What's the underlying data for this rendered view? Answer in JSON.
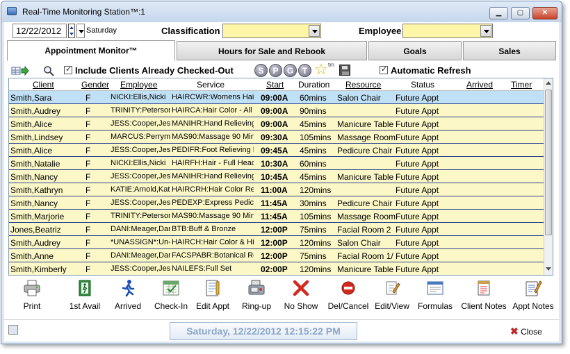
{
  "window": {
    "title": "Real-Time Monitoring Station™:1",
    "min": "▁",
    "max": "▢",
    "close": "✕"
  },
  "filters": {
    "date": "12/22/2012",
    "weekday": "Saturday",
    "classification_label": "Classification",
    "classification_value": "",
    "employee_label": "Employee",
    "employee_value": ""
  },
  "tabs": [
    {
      "label": "Appointment Monitor™",
      "active": true
    },
    {
      "label": "Hours for Sale and Rebook"
    },
    {
      "label": "Goals"
    },
    {
      "label": "Sales"
    }
  ],
  "toolbar": {
    "include_checked_out_label": "Include Clients Already Checked-Out",
    "include_checked_out": true,
    "circles": [
      "S",
      "P",
      "G",
      "T"
    ],
    "tm": "tm",
    "auto_refresh_label": "Automatic Refresh",
    "auto_refresh": true
  },
  "grid": {
    "columns": [
      "Client",
      "Gender",
      "Employee",
      "Service",
      "Start",
      "Duration",
      "Resource",
      "Status",
      "Arrived",
      "Timer"
    ],
    "rows": [
      {
        "client": "Smith,Sara",
        "gender": "F",
        "employee": "NICKI:Ellis,Nicki",
        "service": "HAIRCWR:Womens Hair",
        "start": "09:00A",
        "duration": "60mins",
        "resource": "Salon Chair",
        "status": "Future Appt",
        "arrived": "",
        "timer": ""
      },
      {
        "client": "Smith,Audrey",
        "gender": "F",
        "employee": "TRINITY:Peterson",
        "service": "HAIRCA:Hair Color - All",
        "start": "09:00A",
        "duration": "90mins",
        "resource": "",
        "status": "Future Appt",
        "arrived": "",
        "timer": ""
      },
      {
        "client": "Smith,Alice",
        "gender": "F",
        "employee": "JESS:Cooper,Jes",
        "service": "MANIHR:Hand Relieving",
        "start": "09:00A",
        "duration": "45mins",
        "resource": "Manicure Table",
        "status": "Future Appt",
        "arrived": "",
        "timer": ""
      },
      {
        "client": "Smith,Lindsey",
        "gender": "F",
        "employee": "MARCUS:Perrym",
        "service": "MAS90:Massage 90 Min",
        "start": "09:30A",
        "duration": "105mins",
        "resource": "Massage Room",
        "status": "Future Appt",
        "arrived": "",
        "timer": ""
      },
      {
        "client": "Smith,Alice",
        "gender": "F",
        "employee": "JESS:Cooper,Jes",
        "service": "PEDIFR:Foot Relieving P",
        "start": "09:45A",
        "duration": "45mins",
        "resource": "Pedicure Chair",
        "status": "Future Appt",
        "arrived": "",
        "timer": ""
      },
      {
        "client": "Smith,Natalie",
        "gender": "F",
        "employee": "NICKI:Ellis,Nicki",
        "service": "HAIRFH:Hair - Full Head",
        "start": "10:30A",
        "duration": "60mins",
        "resource": "",
        "status": "Future Appt",
        "arrived": "",
        "timer": ""
      },
      {
        "client": "Smith,Nancy",
        "gender": "F",
        "employee": "JESS:Cooper,Jes",
        "service": "MANIHR:Hand Relieving",
        "start": "10:45A",
        "duration": "45mins",
        "resource": "Manicure Table",
        "status": "Future Appt",
        "arrived": "",
        "timer": ""
      },
      {
        "client": "Smith,Kathryn",
        "gender": "F",
        "employee": "KATIE:Arnold,Kat",
        "service": "HAIRCRH:Hair Color Ret",
        "start": "11:00A",
        "duration": "120mins",
        "resource": "",
        "status": "Future Appt",
        "arrived": "",
        "timer": ""
      },
      {
        "client": "Smith,Nancy",
        "gender": "F",
        "employee": "JESS:Cooper,Jes",
        "service": "PEDEXP:Express Pedicu",
        "start": "11:45A",
        "duration": "30mins",
        "resource": "Pedicure Chair",
        "status": "Future Appt",
        "arrived": "",
        "timer": ""
      },
      {
        "client": "Smith,Marjorie",
        "gender": "F",
        "employee": "TRINITY:Peterson",
        "service": "MAS90:Massage 90 Min",
        "start": "11:45A",
        "duration": "105mins",
        "resource": "Massage Room",
        "status": "Future Appt",
        "arrived": "",
        "timer": ""
      },
      {
        "client": "Jones,Beatriz",
        "gender": "F",
        "employee": "DANI:Meager,Dan",
        "service": "BTB:Buff & Bronze",
        "start": "12:00P",
        "duration": "75mins",
        "resource": "Facial Room 2",
        "status": "Future Appt",
        "arrived": "",
        "timer": ""
      },
      {
        "client": "Smith,Audrey",
        "gender": "F",
        "employee": "*UNASSIGN*:Un-/",
        "service": "HAIRCH:Hair Color & Hig",
        "start": "12:00P",
        "duration": "120mins",
        "resource": "Salon Chair",
        "status": "Future Appt",
        "arrived": "",
        "timer": ""
      },
      {
        "client": "Smith,Anne",
        "gender": "F",
        "employee": "DANI:Meager,Dar",
        "service": "FACSPABR:Botanical Re",
        "start": "12:00P",
        "duration": "75mins",
        "resource": "Facial Room 1/",
        "status": "Future Appt",
        "arrived": "",
        "timer": ""
      },
      {
        "client": "Smith,Kimberly",
        "gender": "F",
        "employee": "JESS:Cooper,Jes",
        "service": "NAILEFS:Full Set",
        "start": "02:00P",
        "duration": "120mins",
        "resource": "Manicure Table",
        "status": "Future Appt",
        "arrived": "",
        "timer": ""
      }
    ]
  },
  "actions": [
    {
      "name": "print-button",
      "icon": "printer-icon",
      "label": "Print"
    },
    {
      "name": "first-available-button",
      "icon": "door-exit-icon",
      "label": "1st Avail"
    },
    {
      "name": "arrived-button",
      "icon": "running-person-icon",
      "label": "Arrived"
    },
    {
      "name": "check-in-button",
      "icon": "calendar-check-icon",
      "label": "Check-In"
    },
    {
      "name": "edit-appt-button",
      "icon": "edit-notebook-icon",
      "label": "Edit Appt"
    },
    {
      "name": "ring-up-button",
      "icon": "cash-register-icon",
      "label": "Ring-up"
    },
    {
      "name": "no-show-button",
      "icon": "red-x-icon",
      "label": "No Show"
    },
    {
      "name": "del-cancel-button",
      "icon": "no-entry-icon",
      "label": "Del/Cancel"
    },
    {
      "name": "edit-view-button",
      "icon": "pencil-note-icon",
      "label": "Edit/View"
    },
    {
      "name": "formulas-button",
      "icon": "formula-window-icon",
      "label": "Formulas"
    },
    {
      "name": "client-notes-button",
      "icon": "notepad-icon",
      "label": "Client Notes"
    },
    {
      "name": "appt-notes-button",
      "icon": "notepad-pen-icon",
      "label": "Appt Notes"
    }
  ],
  "status": {
    "datetime": "Saturday, 12/22/2012 12:15:22 PM",
    "close_label": "Close"
  },
  "colors": {
    "row_yellow": "#fbf7c6",
    "row_selected": "#bfe0f5",
    "row_separator": "#2a3e8c",
    "field_yellow": "#fdf6a6"
  }
}
